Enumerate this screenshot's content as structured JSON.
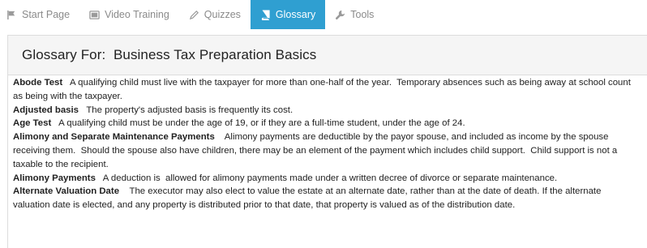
{
  "tabs": [
    {
      "label": "Start Page",
      "icon": "flag-icon",
      "active": false
    },
    {
      "label": "Video Training",
      "icon": "video-icon",
      "active": false
    },
    {
      "label": "Quizzes",
      "icon": "pencil-icon",
      "active": false
    },
    {
      "label": "Glossary",
      "icon": "book-icon",
      "active": true
    },
    {
      "label": "Tools",
      "icon": "wrench-icon",
      "active": false
    }
  ],
  "colors": {
    "accent": "#2f9fd1",
    "tab_text": "#8a8a8a",
    "panel_header_bg": "#f5f5f5"
  },
  "panel": {
    "title": "Glossary For:  Business Tax Preparation Basics"
  },
  "glossary": [
    {
      "term": "Abode Test",
      "definition": "   A qualifying child must live with the taxpayer for more than one-half of the year.  Temporary absences such as being away at school count as being with the taxpayer."
    },
    {
      "term": "Adjusted basis",
      "definition": "   The property's adjusted basis is frequently its cost."
    },
    {
      "term": "Age Test",
      "definition": "   A qualifying child must be under the age of 19, or if they are a full-time student, under the age of 24."
    },
    {
      "term": "Alimony and Separate Maintenance Payments",
      "definition": "    Alimony payments are deductible by the payor spouse, and included as income by the spouse receiving them.  Should the spouse also have children, there may be an element of the payment which includes child support.  Child support is not a taxable to the recipient."
    },
    {
      "term": "Alimony Payments",
      "definition": "   A deduction is  allowed for alimony payments made under a written decree of divorce or separate maintenance."
    },
    {
      "term": "Alternate Valuation Date",
      "definition": "    The executor may also elect to value the estate at an alternate date, rather than at the date of death. If the alternate valuation date is elected, and any property is distributed prior to that date, that property is valued as of the distribution date."
    }
  ]
}
